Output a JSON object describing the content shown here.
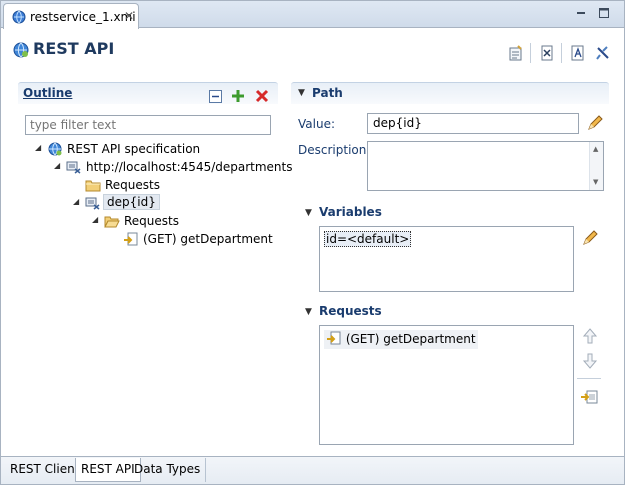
{
  "editor_tab": {
    "title": "restservice_1.xmi",
    "close_glyph": "✕"
  },
  "form": {
    "title": "REST API"
  },
  "outline": {
    "title": "Outline",
    "filter_placeholder": "type filter text",
    "tree": [
      {
        "label": "REST API specification",
        "icon": "rest-api-icon"
      },
      {
        "label": "http://localhost:4545/departments",
        "icon": "resource-icon"
      },
      {
        "label": "Requests",
        "icon": "folder-icon"
      },
      {
        "label": "dep{id}",
        "icon": "resource-icon"
      },
      {
        "label": "Requests",
        "icon": "folder-icon"
      },
      {
        "label": "(GET) getDepartment",
        "icon": "request-icon"
      }
    ]
  },
  "path": {
    "title": "Path",
    "value_label": "Value:",
    "value": "dep{id}",
    "description_label": "Description:",
    "description": "",
    "variables": {
      "title": "Variables",
      "items": [
        "id=<default>"
      ]
    },
    "requests": {
      "title": "Requests",
      "items": [
        "(GET) getDepartment"
      ]
    }
  },
  "bottom_tabs": [
    "REST Client",
    "REST API",
    "Data Types"
  ],
  "active_bottom_tab": "REST API"
}
